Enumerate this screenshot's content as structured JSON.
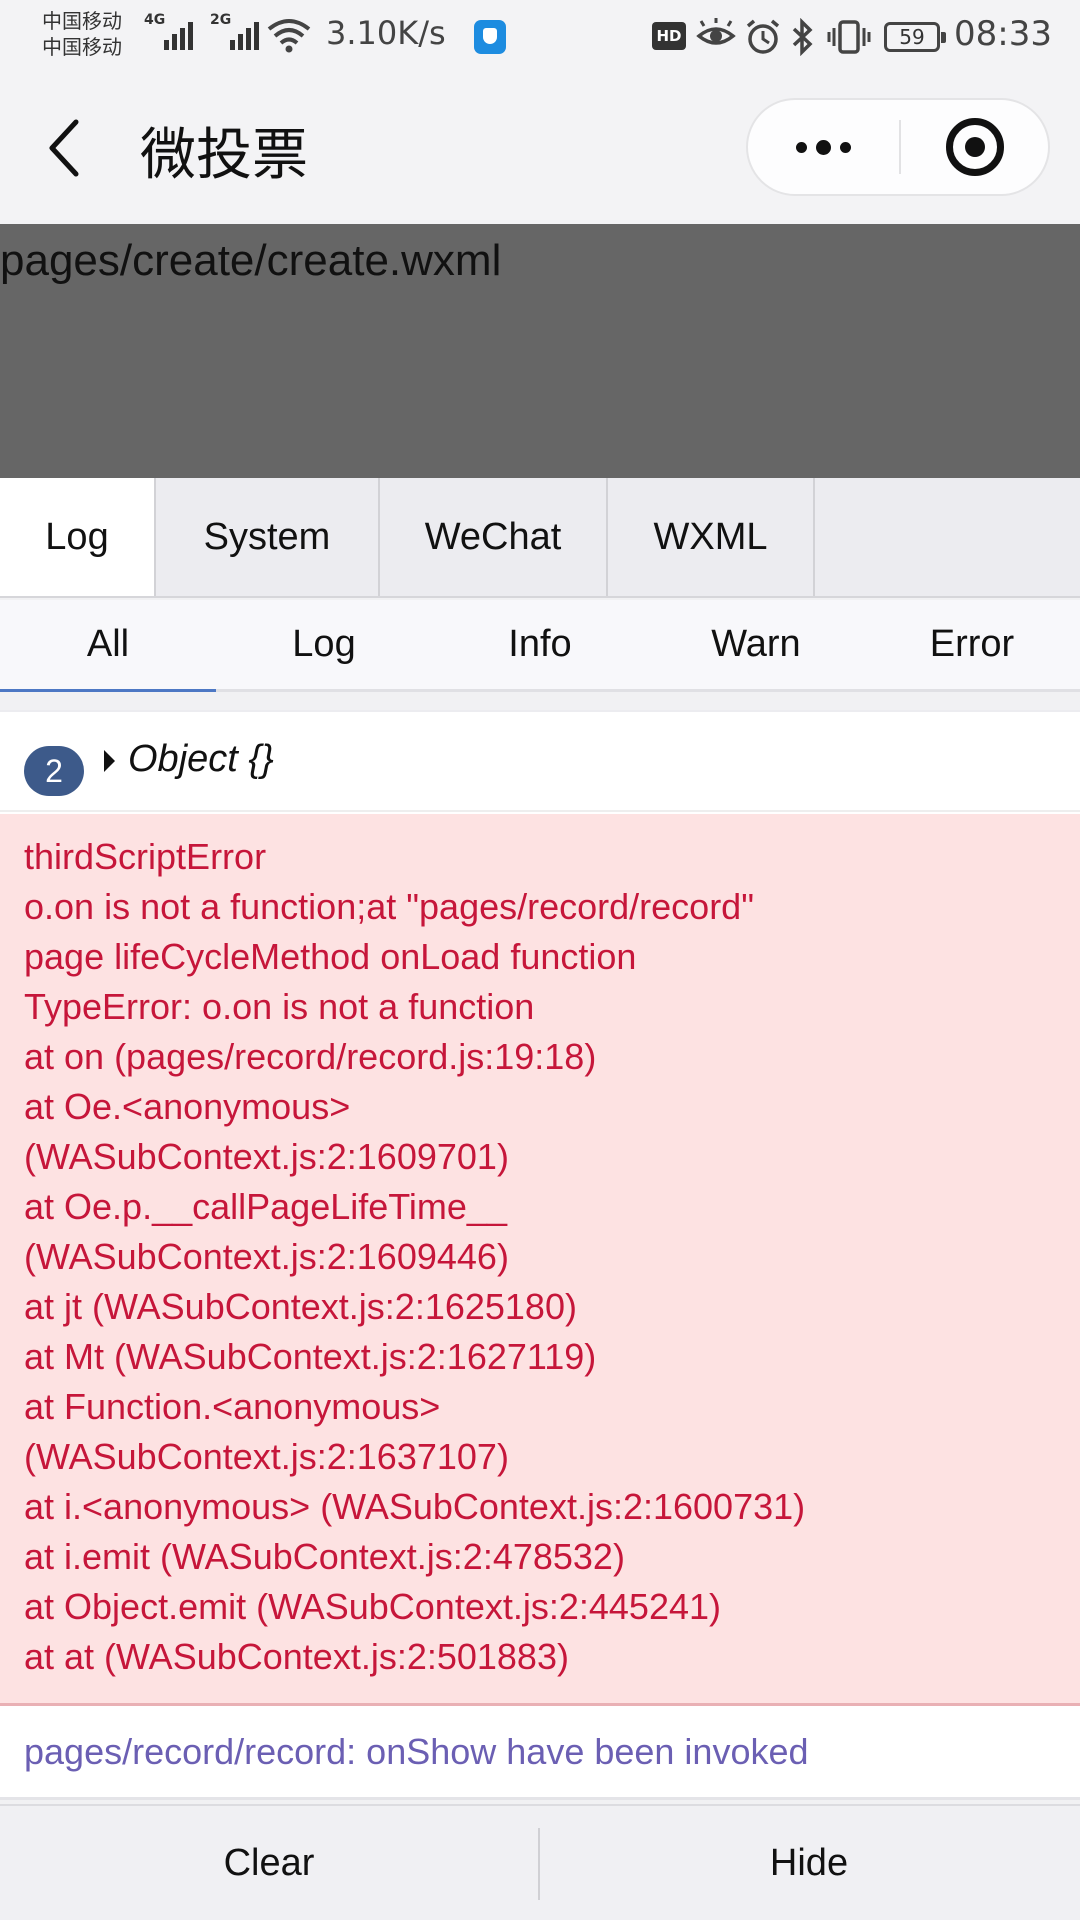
{
  "status_bar": {
    "carrier_1": "中国移动",
    "carrier_2": "中国移动",
    "net_type_1": "4G",
    "net_type_2": "2G",
    "speed": "3.10K/s",
    "hd": "HD",
    "battery": "59",
    "time": "08:33"
  },
  "nav": {
    "title": "微投票"
  },
  "page": {
    "path": "pages/create/create.wxml"
  },
  "tabs": [
    "Log",
    "System",
    "WeChat",
    "WXML"
  ],
  "filters": [
    "All",
    "Log",
    "Info",
    "Warn",
    "Error"
  ],
  "log": {
    "object_count": "2",
    "object_label": "Object {}",
    "error_lines": [
      "thirdScriptError",
      "o.on is not a function;at \"pages/record/record\"",
      "page lifeCycleMethod onLoad function",
      "TypeError: o.on is not a function",
      "at on (pages/record/record.js:19:18)",
      "at Oe.<anonymous>",
      "(WASubContext.js:2:1609701)",
      "at Oe.p.__callPageLifeTime__",
      "(WASubContext.js:2:1609446)",
      "at jt (WASubContext.js:2:1625180)",
      "at Mt (WASubContext.js:2:1627119)",
      "at Function.<anonymous>",
      "(WASubContext.js:2:1637107)",
      "at i.<anonymous> (WASubContext.js:2:1600731)",
      "at i.emit (WASubContext.js:2:478532)",
      "at Object.emit (WASubContext.js:2:445241)",
      "at at (WASubContext.js:2:501883)"
    ],
    "info_line": "pages/record/record: onShow have been invoked"
  },
  "bottom": {
    "clear_label": "Clear",
    "hide_label": "Hide"
  },
  "colors": {
    "error_text": "#c6163a",
    "error_bg": "#fde2e2",
    "info_text": "#6b5fb3",
    "badge": "#3d5a8a",
    "active_filter": "#4d78c4",
    "page_bg": "#666666"
  },
  "icons": [
    "back-arrow-icon",
    "more-dots-icon",
    "close-target-icon",
    "wifi-icon",
    "eye-icon",
    "alarm-icon",
    "bluetooth-icon",
    "vibrate-icon",
    "battery-icon",
    "signal-icon",
    "app-shield-icon"
  ]
}
